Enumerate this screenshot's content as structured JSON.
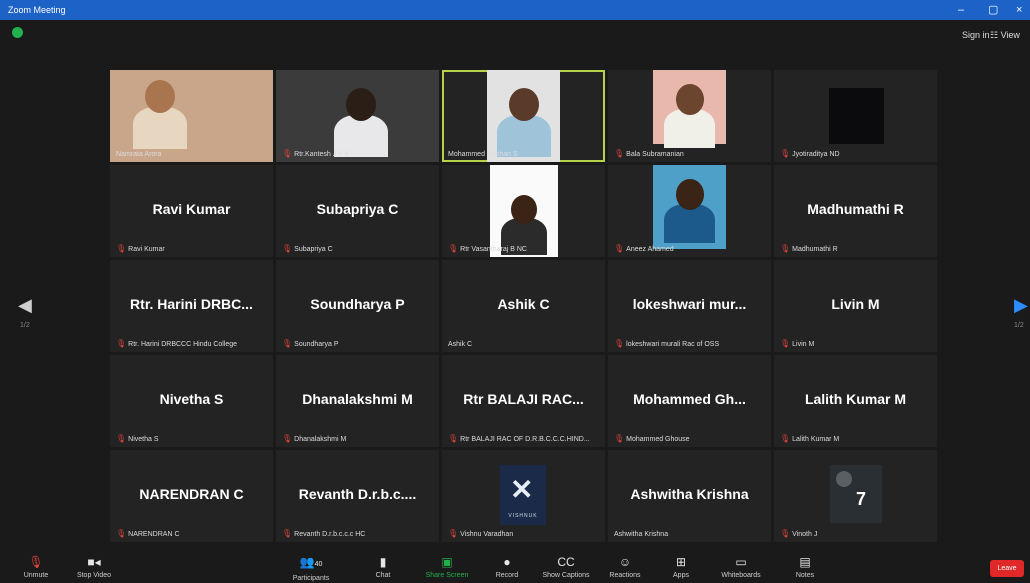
{
  "window": {
    "title": "Zoom Meeting"
  },
  "top": {
    "sign_in": "Sign in",
    "view": "View"
  },
  "pagination": {
    "left": "1/2",
    "right": "1/2"
  },
  "participants": [
    {
      "big": "",
      "label": "Namrata Arora",
      "mic": false
    },
    {
      "big": "",
      "label": "Rtr.Kantesh J V K",
      "mic": true
    },
    {
      "big": "",
      "label": "Mohammed Subhan S",
      "mic": false
    },
    {
      "big": "",
      "label": "Bala Subramanian",
      "mic": true
    },
    {
      "big": "",
      "label": "Jyotiraditya ND",
      "mic": true
    },
    {
      "big": "Ravi Kumar",
      "label": "Ravi Kumar",
      "mic": true
    },
    {
      "big": "Subapriya C",
      "label": "Subapriya C",
      "mic": true
    },
    {
      "big": "",
      "label": "Rtr Vasantharaj B NC",
      "mic": true
    },
    {
      "big": "",
      "label": "Aneez Ahamed",
      "mic": true
    },
    {
      "big": "Madhumathi R",
      "label": "Madhumathi R",
      "mic": true
    },
    {
      "big": "Rtr. Harini DRBC...",
      "label": "Rtr. Harini DRBCCC Hindu College",
      "mic": true
    },
    {
      "big": "Soundharya P",
      "label": "Soundharya P",
      "mic": true
    },
    {
      "big": "Ashik C",
      "label": "Ashik C",
      "mic": false
    },
    {
      "big": "lokeshwari mur...",
      "label": "lokeshwari murali Rac of OSS",
      "mic": true
    },
    {
      "big": "Livin M",
      "label": "Livin M",
      "mic": true
    },
    {
      "big": "Nivetha S",
      "label": "Nivetha S",
      "mic": true
    },
    {
      "big": "Dhanalakshmi M",
      "label": "Dhanalakshmi M",
      "mic": true
    },
    {
      "big": "Rtr BALAJI RAC...",
      "label": "Rtr BALAJI RAC OF D.R.B.C.C.C.HIND...",
      "mic": true
    },
    {
      "big": "Mohammed Gh...",
      "label": "Mohammed Ghouse",
      "mic": true
    },
    {
      "big": "Lalith Kumar M",
      "label": "Lalith Kumar M",
      "mic": true
    },
    {
      "big": "NARENDRAN C",
      "label": "NARENDRAN C",
      "mic": true
    },
    {
      "big": "Revanth D.r.b.c....",
      "label": "Revanth D.r.b.c.c.c HC",
      "mic": true
    },
    {
      "big": "",
      "label": "Vishnu Varadhan",
      "mic": true
    },
    {
      "big": "Ashwitha Krishna",
      "label": "Ashwitha Krishna",
      "mic": false
    },
    {
      "big": "",
      "label": "Vinoth J",
      "mic": true
    }
  ],
  "vishnu_logo_text": "VISHNUK",
  "vinoth_jersey": "7",
  "toolbar": {
    "unmute": "Unmute",
    "stop_video": "Stop Video",
    "participants": "Participants",
    "participants_count": "40",
    "chat": "Chat",
    "share_screen": "Share Screen",
    "record": "Record",
    "show_captions": "Show Captions",
    "reactions": "Reactions",
    "apps": "Apps",
    "whiteboards": "Whiteboards",
    "notes": "Notes",
    "leave": "Leave"
  },
  "colors": {
    "accent": "#1c62c7",
    "active_speaker": "#b6d24b",
    "muted": "#e0463c",
    "leave": "#e02828",
    "share": "#23b14d"
  }
}
